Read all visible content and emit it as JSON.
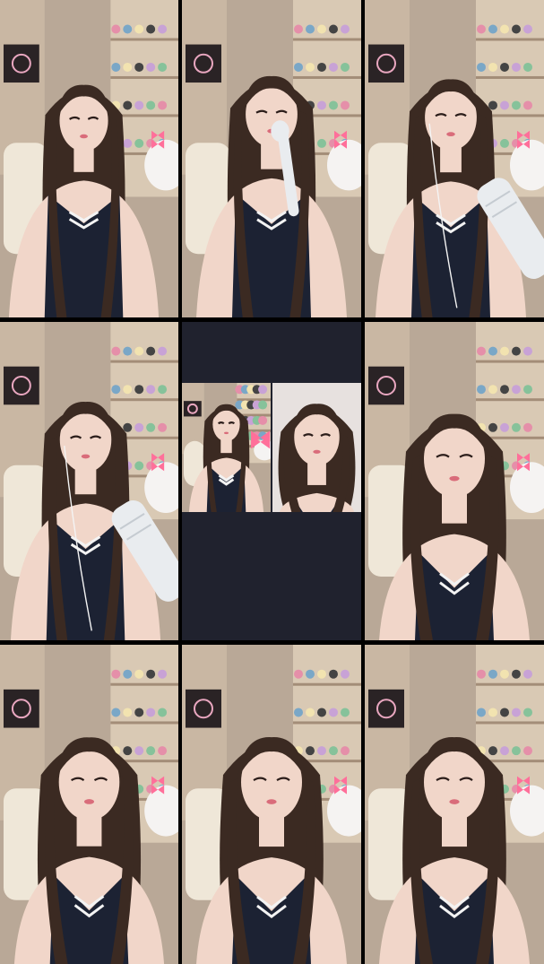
{
  "layout": {
    "columns": 3,
    "rows": 3
  },
  "tiles": [
    {
      "id": "tile-1",
      "subject": "streamer",
      "variant": "no-mic"
    },
    {
      "id": "tile-2",
      "subject": "streamer",
      "variant": "handheld-mic"
    },
    {
      "id": "tile-3",
      "subject": "streamer",
      "variant": "stand-mic"
    },
    {
      "id": "tile-4",
      "subject": "streamer",
      "variant": "stand-mic"
    },
    {
      "id": "tile-5",
      "subject": "split-screen",
      "variant": "two-person-inset"
    },
    {
      "id": "tile-6",
      "subject": "streamer",
      "variant": "close"
    },
    {
      "id": "tile-7",
      "subject": "streamer",
      "variant": "close"
    },
    {
      "id": "tile-8",
      "subject": "streamer",
      "variant": "close"
    },
    {
      "id": "tile-9",
      "subject": "streamer",
      "variant": "close"
    }
  ],
  "colors": {
    "background_room": "#b9a897",
    "shelf": "#d9c9b4",
    "hair": "#3b2a22",
    "skin": "#f1d6c9",
    "uniform": "#1c2233",
    "split_screen_bg": "#20222e",
    "plush_bow": "#ff6f9a",
    "mic": "#e9ecef"
  }
}
